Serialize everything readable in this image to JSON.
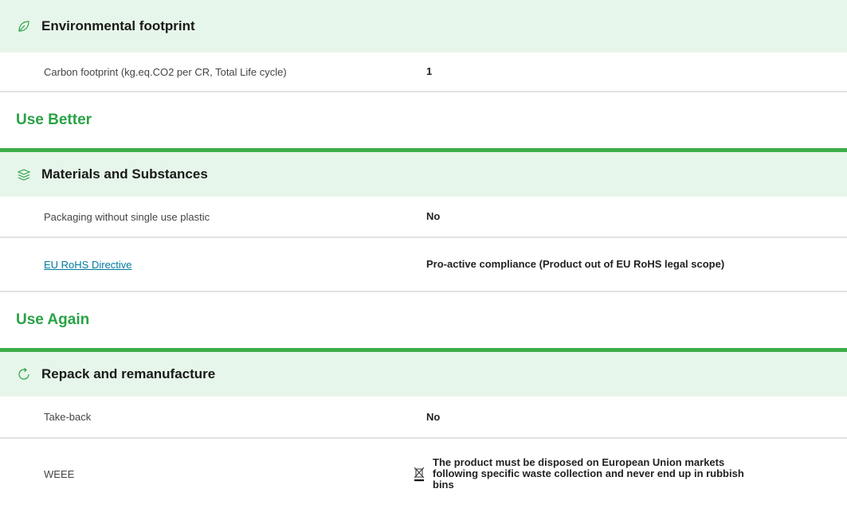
{
  "sections": {
    "env": {
      "group_title": "Environmental footprint",
      "icon": "leaf-icon",
      "rows": [
        {
          "label": "Carbon footprint (kg.eq.CO2 per CR, Total Life cycle)",
          "value": "1"
        }
      ]
    },
    "use_better": {
      "title": "Use Better",
      "group_title": "Materials and Substances",
      "icon": "layers-icon",
      "rows": [
        {
          "label": "Packaging without single use plastic",
          "value": "No"
        },
        {
          "label": "EU RoHS Directive",
          "value": "Pro-active compliance (Product out of EU RoHS legal scope)",
          "is_link": true
        }
      ]
    },
    "use_again": {
      "title": "Use Again",
      "group_title": "Repack and remanufacture",
      "icon": "refresh-icon",
      "rows": [
        {
          "label": "Take-back",
          "value": "No"
        },
        {
          "label": "WEEE",
          "value": "The product must be disposed on European Union markets following specific waste collection and never end up in rubbish bins",
          "icon": "crossed-bin-icon"
        }
      ]
    }
  },
  "colors": {
    "accent_green": "#2aa246",
    "rule_green": "#3dae49",
    "header_bg": "#e7f6ea",
    "link": "#007a9e"
  }
}
